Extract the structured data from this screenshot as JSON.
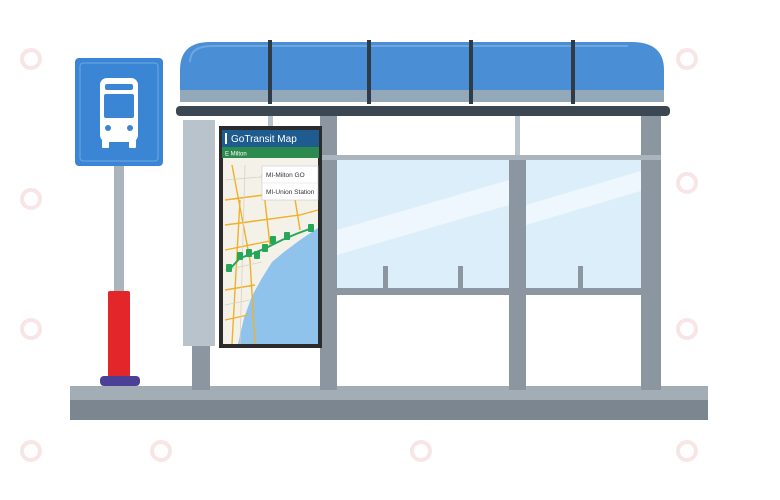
{
  "kiosk": {
    "app_title": "GoTransit Map",
    "location_label": "E Milton",
    "stops": [
      {
        "label": "MI-Milton GO"
      },
      {
        "label": "MI-Union Station"
      }
    ]
  },
  "colors": {
    "roof_blue": "#4a8fd6",
    "roof_band": "#93a8b8",
    "frame_gray": "#8b96a0",
    "glass": "#dbeefa",
    "sign_blue": "#3a86d4",
    "pole_red": "#e3262a",
    "pole_base": "#4b3f96",
    "app_header": "#1e5b8f",
    "route_green": "#26a65b",
    "water": "#8fc3ec"
  },
  "icons": {
    "bus_stop_sign": "bus-icon",
    "map_markers": "location-pin-icon",
    "watermark": "logo-watermark"
  }
}
